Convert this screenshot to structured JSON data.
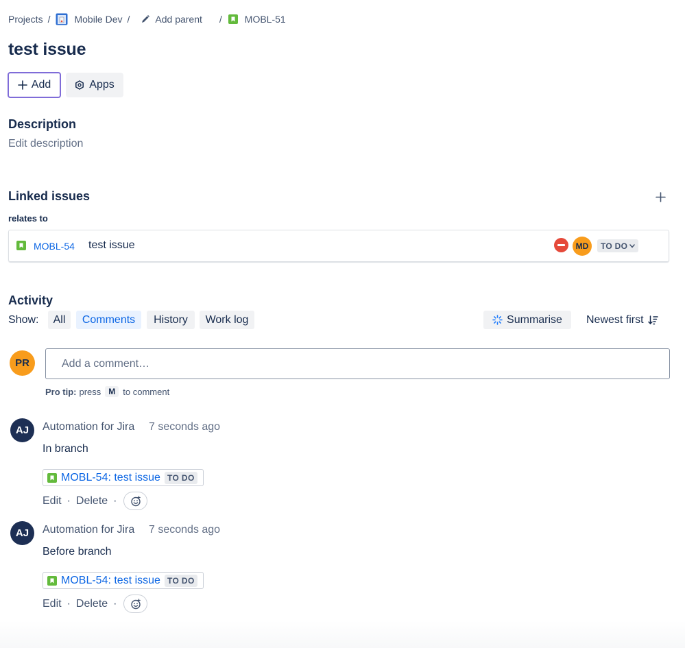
{
  "breadcrumb": {
    "projects": "Projects",
    "project": "Mobile Dev",
    "add_parent": "Add parent",
    "issue_key": "MOBL-51",
    "separator": "/"
  },
  "issue": {
    "title": "test issue"
  },
  "actions": {
    "add_label": "Add",
    "apps_label": "Apps"
  },
  "description": {
    "heading": "Description",
    "placeholder": "Edit description"
  },
  "linked_issues": {
    "heading": "Linked issues",
    "relation": "relates to",
    "items": [
      {
        "key": "MOBL-54",
        "summary": "test issue",
        "assignee_initials": "MD",
        "status": "TO DO"
      }
    ]
  },
  "activity": {
    "heading": "Activity",
    "show_label": "Show:",
    "filters": [
      "All",
      "Comments",
      "History",
      "Work log"
    ],
    "active_filter": "Comments",
    "summarise_label": "Summarise",
    "sort_label": "Newest first"
  },
  "comment_box": {
    "user_initials": "PR",
    "placeholder": "Add a comment…",
    "protip_bold": "Pro tip:",
    "protip_press": "press",
    "protip_key": "M",
    "protip_rest": "to comment"
  },
  "comments": [
    {
      "initials": "AJ",
      "author": "Automation for Jira",
      "time": "7 seconds ago",
      "body": "In branch",
      "card_link": "MOBL-54: test issue",
      "card_status": "TO DO",
      "edit": "Edit",
      "delete": "Delete",
      "dot": "·"
    },
    {
      "initials": "AJ",
      "author": "Automation for Jira",
      "time": "7 seconds ago",
      "body": "Before branch",
      "card_link": "MOBL-54: test issue",
      "card_status": "TO DO",
      "edit": "Edit",
      "delete": "Delete",
      "dot": "·"
    }
  ],
  "colors": {
    "link_blue": "#0c66e4",
    "story_green": "#63ba3c",
    "priority_red": "#e5493a",
    "avatar_orange": "#f89c1c",
    "avatar_navy": "#1d2f54",
    "focus_purple": "#7f6cd8"
  },
  "icons": [
    "project-icon",
    "pencil-icon",
    "story-icon",
    "plus-icon",
    "apps-icon",
    "priority-blocker-icon",
    "chevron-down-icon",
    "sparkle-icon",
    "sort-icon",
    "emoji-add-icon"
  ]
}
